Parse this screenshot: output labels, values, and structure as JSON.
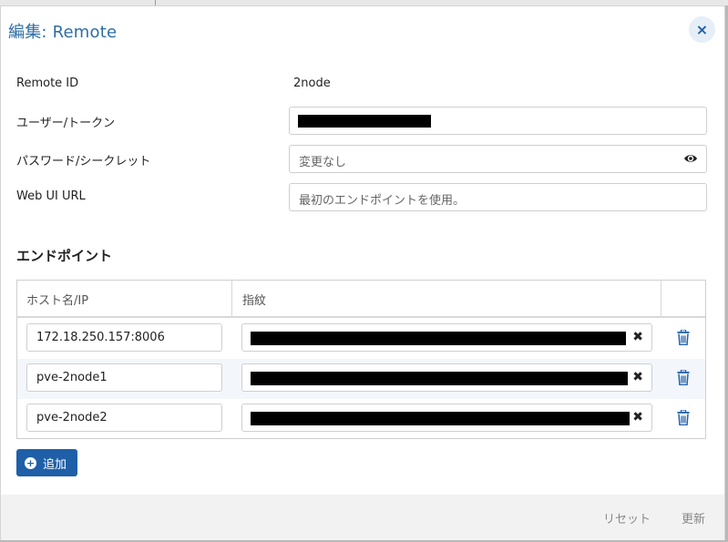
{
  "dialog": {
    "title": "編集: Remote",
    "close_icon": "×"
  },
  "form": {
    "remote_id_label": "Remote ID",
    "remote_id_value": "2node",
    "user_label": "ユーザー/トークン",
    "password_label": "パスワード/シークレット",
    "password_placeholder": "変更なし",
    "web_url_label": "Web UI URL",
    "web_url_placeholder": "最初のエンドポイントを使用。"
  },
  "endpoints": {
    "title": "エンドポイント",
    "columns": [
      "ホスト名/IP",
      "指紋"
    ],
    "rows": [
      {
        "host": "172.18.250.157:8006"
      },
      {
        "host": "pve-2node1"
      },
      {
        "host": "pve-2node2"
      }
    ],
    "clear_icon": "✖",
    "add_label": "追加"
  },
  "footer": {
    "reset_label": "リセット",
    "update_label": "更新"
  },
  "colors": {
    "accent": "#1f5fa8",
    "title": "#2e6da4"
  },
  "icons": {
    "close": "close-icon",
    "eye": "eye-icon",
    "trash": "trash-icon",
    "plus": "plus-circle-icon"
  }
}
